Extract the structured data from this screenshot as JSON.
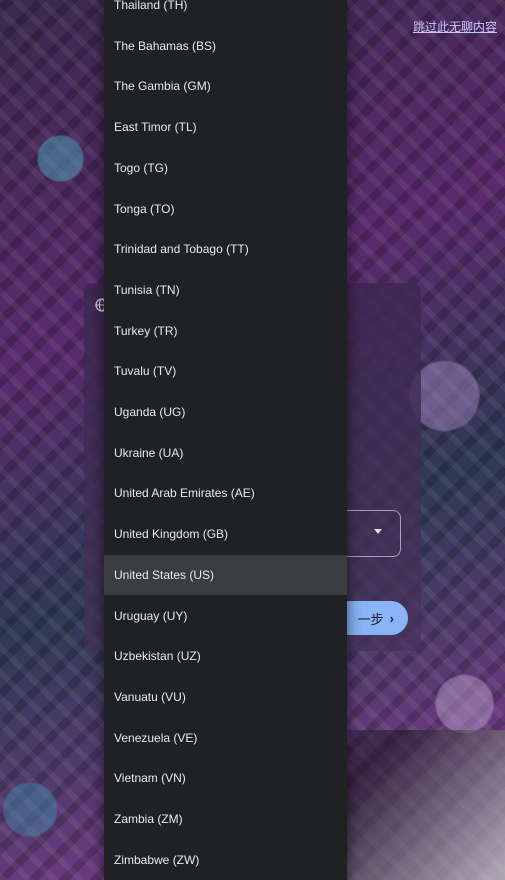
{
  "skip_link": "跳过此无聊内容",
  "next_button": {
    "label": "下一步",
    "partial_label": "一步"
  },
  "dropdown": {
    "selected": "United States (US)",
    "options": [
      "Thailand (TH)",
      "The Bahamas (BS)",
      "The Gambia (GM)",
      "East Timor (TL)",
      "Togo (TG)",
      "Tonga (TO)",
      "Trinidad and Tobago (TT)",
      "Tunisia (TN)",
      "Turkey (TR)",
      "Tuvalu (TV)",
      "Uganda (UG)",
      "Ukraine (UA)",
      "United Arab Emirates (AE)",
      "United Kingdom (GB)",
      "United States (US)",
      "Uruguay (UY)",
      "Uzbekistan (UZ)",
      "Vanuatu (VU)",
      "Venezuela (VE)",
      "Vietnam (VN)",
      "Zambia (ZM)",
      "Zimbabwe (ZW)"
    ]
  },
  "colors": {
    "dropdown_bg": "#202124",
    "selected_bg": "#3c3d40",
    "next_button": "#8ab4f8"
  }
}
